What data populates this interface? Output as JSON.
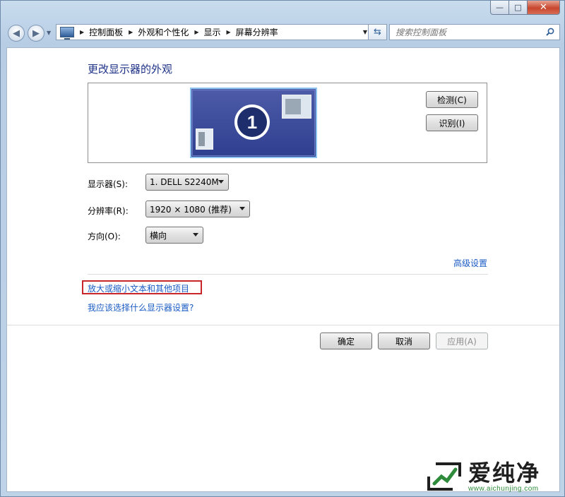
{
  "window": {
    "minimize_glyph": "—",
    "maximize_glyph": "□",
    "close_glyph": "✕"
  },
  "nav": {
    "breadcrumb": [
      "控制面板",
      "外观和个性化",
      "显示",
      "屏幕分辨率"
    ],
    "search_placeholder": "搜索控制面板"
  },
  "main": {
    "heading": "更改显示器的外观",
    "monitor_number": "1",
    "detect_label": "检测(C)",
    "identify_label": "识别(I)",
    "display_label": "显示器(S):",
    "display_value": "1. DELL S2240M",
    "resolution_label": "分辨率(R):",
    "resolution_value": "1920 × 1080 (推荐)",
    "orientation_label": "方向(O):",
    "orientation_value": "横向",
    "advanced_link": "高级设置",
    "text_size_link": "放大或缩小文本和其他项目",
    "help_link": "我应该选择什么显示器设置?"
  },
  "footer": {
    "ok_label": "确定",
    "cancel_label": "取消",
    "apply_label": "应用(A)"
  },
  "watermark": {
    "brand": "爱纯净",
    "url": "www.aichunjing.com"
  },
  "colors": {
    "heading": "#1e3287",
    "link": "#1a5bc4",
    "highlight_border": "#c8262b",
    "watermark_green": "#2d8b3b"
  }
}
